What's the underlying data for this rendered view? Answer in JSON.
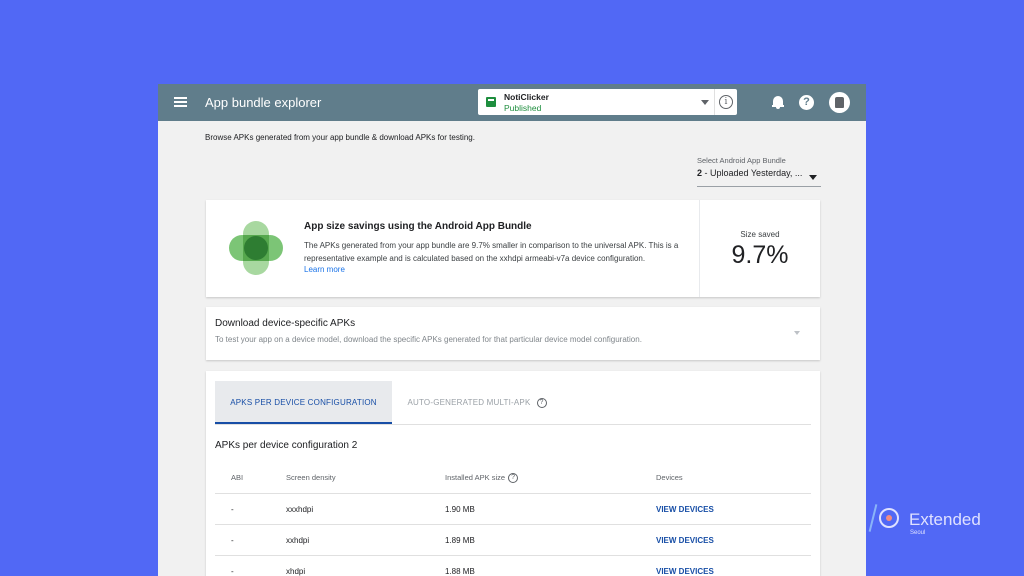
{
  "topbar": {
    "title": "App bundle explorer",
    "app_name": "NotiClicker",
    "app_status": "Published",
    "info_icon": "i",
    "help_icon": "?"
  },
  "intro": "Browse APKs generated from your app bundle & download APKs for testing.",
  "bundle_select": {
    "label": "Select Android App Bundle",
    "number": "2",
    "value": " - Uploaded Yesterday, ..."
  },
  "savings": {
    "title": "App size savings using the Android App Bundle",
    "text": "The APKs generated from your app bundle are 9.7% smaller in comparison to the universal APK. This is a representative example and is calculated based on the xxhdpi armeabi-v7a device configuration.",
    "link": "Learn more",
    "size_label": "Size saved",
    "size_value": "9.7%"
  },
  "download": {
    "title": "Download device-specific APKs",
    "subtitle": "To test your app on a device model, download the specific APKs generated for that particular device model configuration."
  },
  "apk_section": {
    "tabs": [
      {
        "label": "APKS PER DEVICE CONFIGURATION"
      },
      {
        "label": "AUTO-GENERATED MULTI-APK"
      }
    ],
    "title": "APKs per device configuration 2",
    "columns": [
      "ABI",
      "Screen density",
      "Installed APK size",
      "Devices"
    ],
    "rows": [
      {
        "abi": "-",
        "density": "xxxhdpi",
        "size": "1.90 MB",
        "devices": "VIEW DEVICES"
      },
      {
        "abi": "-",
        "density": "xxhdpi",
        "size": "1.89 MB",
        "devices": "VIEW DEVICES"
      },
      {
        "abi": "-",
        "density": "xhdpi",
        "size": "1.88 MB",
        "devices": "VIEW DEVICES"
      }
    ]
  },
  "brand": {
    "name": "Extended",
    "city": "Seoul"
  },
  "colors": {
    "background": "#5168f5",
    "topbar": "#607d8b",
    "link": "#1a73e8",
    "accent": "#174ea6",
    "published": "#1e8e3e"
  },
  "icons": [
    "menu-icon",
    "app-icon",
    "chevron-down-icon",
    "info-icon",
    "bell-icon",
    "help-icon",
    "avatar",
    "android-bundle-logo",
    "question-icon"
  ]
}
